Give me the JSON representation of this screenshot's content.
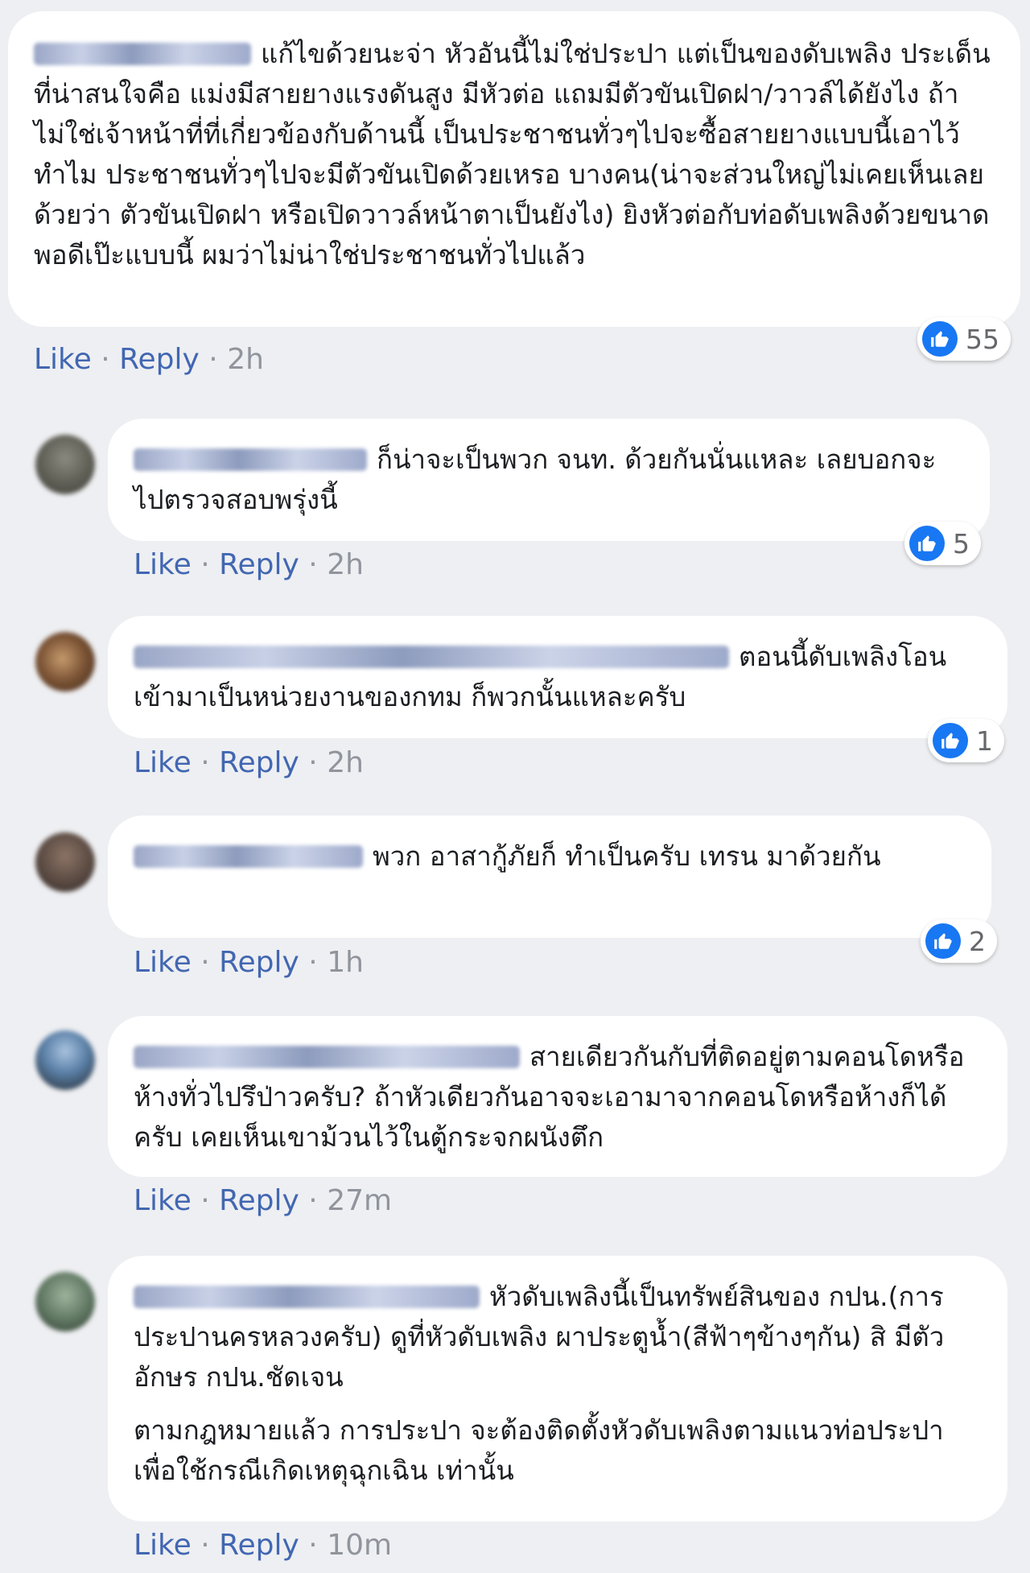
{
  "actions": {
    "like": "Like",
    "reply": "Reply",
    "sep": "·"
  },
  "reaction_icon": "like-thumb-icon",
  "like_color": "#1877f2",
  "comments": [
    {
      "text": "แก้ไขด้วยนะจ่า หัวอันนี้ไม่ใช่ประปา แต่เป็นของดับเพลิง ประเด็นที่น่าสนใจคือ แม่งมีสายยางแรงดันสูง มีหัวต่อ แถมมีตัวขันเปิดฝา/วาวล์ได้ยังไง ถ้าไม่ใช่เจ้าหน้าที่ที่เกี่ยวข้องกับด้านนี้ เป็นประชาชนทั่วๆไปจะซื้อสายยางแบบนี้เอาไว้ทำไม ประชาชนทั่วๆไปจะมีตัวขันเปิดด้วยเหรอ บางคน(น่าจะส่วนใหญ่ไม่เคยเห็นเลยด้วยว่า ตัวขันเปิดฝา หรือเปิดวาวล์หน้าตาเป็นยังไง) ยิงหัวต่อกับท่อดับเพลิงด้วยขนาดพอดีเป๊ะแบบนี้ ผมว่าไม่น่าใช่ประชาชนทั่วไปแล้ว",
      "time": "2h",
      "reactions": "55"
    },
    {
      "text": "ก็น่าจะเป็นพวก จนท. ด้วยกันนั่นแหละ เลยบอกจะไปตรวจสอบพรุ่งนี้",
      "time": "2h",
      "reactions": "5"
    },
    {
      "text": "ตอนนี้ดับเพลิงโอนเข้ามาเป็นหน่วยงานของกทม ก็พวกนั้นแหละครับ",
      "time": "2h",
      "reactions": "1"
    },
    {
      "text": "พวก อาสากู้ภัยก็ ทำเป็นครับ เทรน มาด้วยกัน",
      "time": "1h",
      "reactions": "2"
    },
    {
      "text": "สายเดียวกันกับที่ติดอยู่ตามคอนโดหรือห้างทั่วไปรึป่าวครับ? ถ้าหัวเดียวกันอาจจะเอามาจากคอนโดหรือห้างก็ได้ครับ เคยเห็นเขาม้วนไว้ในตู้กระจกผนังตึก",
      "time": "27m",
      "reactions": ""
    },
    {
      "text": "หัวดับเพลิงนี้เป็นทรัพย์สินของ กปน.(การประปานครหลวงครับ) ดูที่หัวดับเพลิง ผาประตูน้ำ(สีฟ้าๆข้างๆกัน) สิ มีตัวอักษร กปน.ชัดเจน",
      "text2": "ตามกฎหมายแล้ว การประปา จะต้องติดตั้งหัวดับเพลิงตามแนวท่อประปา เพื่อใช้กรณีเกิดเหตุฉุกเฉิน เท่านั้น",
      "time": "10m",
      "reactions": ""
    }
  ]
}
